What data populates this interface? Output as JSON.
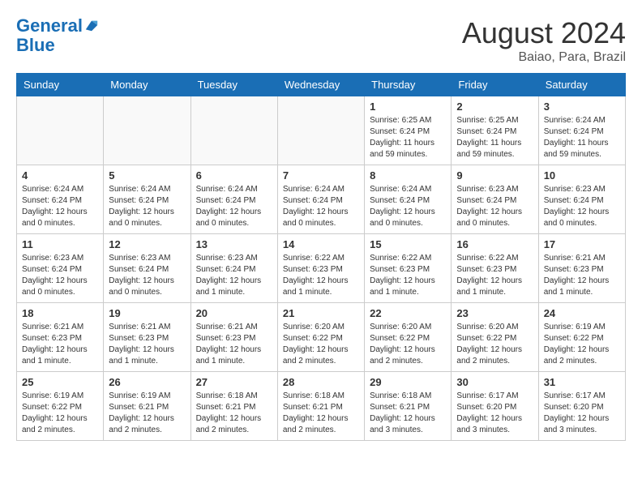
{
  "header": {
    "logo_line1": "General",
    "logo_line2": "Blue",
    "month_year": "August 2024",
    "location": "Baiao, Para, Brazil"
  },
  "weekdays": [
    "Sunday",
    "Monday",
    "Tuesday",
    "Wednesday",
    "Thursday",
    "Friday",
    "Saturday"
  ],
  "weeks": [
    [
      {
        "day": "",
        "empty": true
      },
      {
        "day": "",
        "empty": true
      },
      {
        "day": "",
        "empty": true
      },
      {
        "day": "",
        "empty": true
      },
      {
        "day": "1",
        "sunrise": "6:25 AM",
        "sunset": "6:24 PM",
        "daylight": "11 hours and 59 minutes."
      },
      {
        "day": "2",
        "sunrise": "6:25 AM",
        "sunset": "6:24 PM",
        "daylight": "11 hours and 59 minutes."
      },
      {
        "day": "3",
        "sunrise": "6:24 AM",
        "sunset": "6:24 PM",
        "daylight": "11 hours and 59 minutes."
      }
    ],
    [
      {
        "day": "4",
        "sunrise": "6:24 AM",
        "sunset": "6:24 PM",
        "daylight": "12 hours and 0 minutes."
      },
      {
        "day": "5",
        "sunrise": "6:24 AM",
        "sunset": "6:24 PM",
        "daylight": "12 hours and 0 minutes."
      },
      {
        "day": "6",
        "sunrise": "6:24 AM",
        "sunset": "6:24 PM",
        "daylight": "12 hours and 0 minutes."
      },
      {
        "day": "7",
        "sunrise": "6:24 AM",
        "sunset": "6:24 PM",
        "daylight": "12 hours and 0 minutes."
      },
      {
        "day": "8",
        "sunrise": "6:24 AM",
        "sunset": "6:24 PM",
        "daylight": "12 hours and 0 minutes."
      },
      {
        "day": "9",
        "sunrise": "6:23 AM",
        "sunset": "6:24 PM",
        "daylight": "12 hours and 0 minutes."
      },
      {
        "day": "10",
        "sunrise": "6:23 AM",
        "sunset": "6:24 PM",
        "daylight": "12 hours and 0 minutes."
      }
    ],
    [
      {
        "day": "11",
        "sunrise": "6:23 AM",
        "sunset": "6:24 PM",
        "daylight": "12 hours and 0 minutes."
      },
      {
        "day": "12",
        "sunrise": "6:23 AM",
        "sunset": "6:24 PM",
        "daylight": "12 hours and 0 minutes."
      },
      {
        "day": "13",
        "sunrise": "6:23 AM",
        "sunset": "6:24 PM",
        "daylight": "12 hours and 1 minute."
      },
      {
        "day": "14",
        "sunrise": "6:22 AM",
        "sunset": "6:23 PM",
        "daylight": "12 hours and 1 minute."
      },
      {
        "day": "15",
        "sunrise": "6:22 AM",
        "sunset": "6:23 PM",
        "daylight": "12 hours and 1 minute."
      },
      {
        "day": "16",
        "sunrise": "6:22 AM",
        "sunset": "6:23 PM",
        "daylight": "12 hours and 1 minute."
      },
      {
        "day": "17",
        "sunrise": "6:21 AM",
        "sunset": "6:23 PM",
        "daylight": "12 hours and 1 minute."
      }
    ],
    [
      {
        "day": "18",
        "sunrise": "6:21 AM",
        "sunset": "6:23 PM",
        "daylight": "12 hours and 1 minute."
      },
      {
        "day": "19",
        "sunrise": "6:21 AM",
        "sunset": "6:23 PM",
        "daylight": "12 hours and 1 minute."
      },
      {
        "day": "20",
        "sunrise": "6:21 AM",
        "sunset": "6:23 PM",
        "daylight": "12 hours and 1 minute."
      },
      {
        "day": "21",
        "sunrise": "6:20 AM",
        "sunset": "6:22 PM",
        "daylight": "12 hours and 2 minutes."
      },
      {
        "day": "22",
        "sunrise": "6:20 AM",
        "sunset": "6:22 PM",
        "daylight": "12 hours and 2 minutes."
      },
      {
        "day": "23",
        "sunrise": "6:20 AM",
        "sunset": "6:22 PM",
        "daylight": "12 hours and 2 minutes."
      },
      {
        "day": "24",
        "sunrise": "6:19 AM",
        "sunset": "6:22 PM",
        "daylight": "12 hours and 2 minutes."
      }
    ],
    [
      {
        "day": "25",
        "sunrise": "6:19 AM",
        "sunset": "6:22 PM",
        "daylight": "12 hours and 2 minutes."
      },
      {
        "day": "26",
        "sunrise": "6:19 AM",
        "sunset": "6:21 PM",
        "daylight": "12 hours and 2 minutes."
      },
      {
        "day": "27",
        "sunrise": "6:18 AM",
        "sunset": "6:21 PM",
        "daylight": "12 hours and 2 minutes."
      },
      {
        "day": "28",
        "sunrise": "6:18 AM",
        "sunset": "6:21 PM",
        "daylight": "12 hours and 2 minutes."
      },
      {
        "day": "29",
        "sunrise": "6:18 AM",
        "sunset": "6:21 PM",
        "daylight": "12 hours and 3 minutes."
      },
      {
        "day": "30",
        "sunrise": "6:17 AM",
        "sunset": "6:20 PM",
        "daylight": "12 hours and 3 minutes."
      },
      {
        "day": "31",
        "sunrise": "6:17 AM",
        "sunset": "6:20 PM",
        "daylight": "12 hours and 3 minutes."
      }
    ]
  ]
}
